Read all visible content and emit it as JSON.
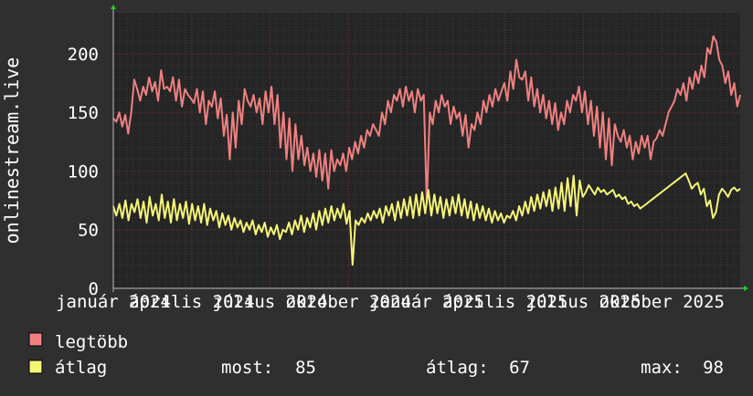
{
  "chart_data": {
    "type": "line",
    "ylabel": "onlinestream.live",
    "ylim": [
      0,
      235
    ],
    "yticks": [
      0,
      50,
      100,
      150,
      200
    ],
    "x_ticks": [
      {
        "pos": 0.0,
        "label": "január 2024"
      },
      {
        "pos": 0.125,
        "label": "április 2024"
      },
      {
        "pos": 0.25,
        "label": "július 2024"
      },
      {
        "pos": 0.375,
        "label": "október 2024"
      },
      {
        "pos": 0.5,
        "label": "január 2025"
      },
      {
        "pos": 0.625,
        "label": "április 2025"
      },
      {
        "pos": 0.75,
        "label": "július 2025"
      },
      {
        "pos": 0.875,
        "label": "október 2025"
      }
    ],
    "grid": true,
    "series": [
      {
        "name": "legtöbb",
        "color": "#f08080",
        "values": [
          145,
          142,
          150,
          138,
          148,
          132,
          150,
          178,
          170,
          160,
          172,
          165,
          180,
          168,
          176,
          160,
          186,
          170,
          172,
          168,
          180,
          160,
          178,
          155,
          170,
          165,
          162,
          158,
          170,
          150,
          168,
          140,
          160,
          155,
          168,
          145,
          162,
          130,
          148,
          110,
          150,
          120,
          160,
          140,
          170,
          160,
          155,
          165,
          150,
          162,
          140,
          168,
          150,
          172,
          140,
          165,
          120,
          150,
          110,
          145,
          100,
          140,
          110,
          130,
          105,
          120,
          100,
          115,
          95,
          118,
          92,
          115,
          85,
          118,
          100,
          110,
          105,
          115,
          100,
          120,
          110,
          125,
          115,
          130,
          120,
          135,
          130,
          140,
          135,
          130,
          150,
          140,
          160,
          150,
          165,
          160,
          170,
          155,
          172,
          160,
          168,
          150,
          170,
          160,
          165,
          72,
          150,
          140,
          160,
          150,
          165,
          155,
          160,
          140,
          155,
          145,
          150,
          130,
          148,
          120,
          140,
          135,
          150,
          140,
          160,
          150,
          165,
          155,
          170,
          160,
          168,
          175,
          160,
          185,
          170,
          195,
          180,
          178,
          185,
          160,
          180,
          155,
          170,
          150,
          165,
          145,
          160,
          140,
          158,
          135,
          150,
          140,
          160,
          150,
          165,
          160,
          172,
          150,
          168,
          140,
          160,
          130,
          155,
          120,
          150,
          110,
          145,
          105,
          140,
          130,
          125,
          135,
          120,
          130,
          110,
          125,
          115,
          130,
          120,
          130,
          110,
          125,
          128,
          135,
          130,
          140,
          150,
          155,
          160,
          170,
          165,
          175,
          160,
          180,
          170,
          185,
          175,
          190,
          180,
          205,
          200,
          215,
          210,
          195,
          190,
          175,
          185,
          165,
          175,
          155,
          165
        ],
        "now": null,
        "avg": null,
        "max": null
      },
      {
        "name": "átlag",
        "color": "#f5f578",
        "values": [
          70,
          62,
          72,
          60,
          75,
          58,
          72,
          65,
          76,
          60,
          74,
          56,
          78,
          62,
          72,
          58,
          80,
          60,
          74,
          56,
          76,
          58,
          72,
          60,
          74,
          55,
          72,
          58,
          70,
          56,
          72,
          54,
          68,
          58,
          66,
          52,
          64,
          54,
          62,
          50,
          60,
          52,
          58,
          48,
          56,
          50,
          58,
          46,
          54,
          48,
          56,
          44,
          52,
          46,
          54,
          42,
          50,
          48,
          56,
          46,
          58,
          50,
          62,
          48,
          60,
          52,
          64,
          50,
          66,
          54,
          68,
          56,
          70,
          58,
          68,
          60,
          72,
          55,
          66,
          20,
          58,
          54,
          60,
          56,
          64,
          58,
          66,
          60,
          68,
          56,
          70,
          62,
          72,
          58,
          74,
          60,
          76,
          62,
          78,
          60,
          80,
          62,
          82,
          64,
          84,
          62,
          80,
          64,
          78,
          60,
          76,
          62,
          78,
          64,
          80,
          62,
          76,
          60,
          74,
          58,
          72,
          60,
          70,
          58,
          68,
          56,
          66,
          58,
          64,
          56,
          62,
          60,
          66,
          58,
          70,
          62,
          74,
          64,
          78,
          66,
          80,
          68,
          82,
          70,
          84,
          66,
          86,
          68,
          90,
          66,
          94,
          70,
          96,
          62,
          92,
          78,
          82,
          88,
          84,
          80,
          86,
          82,
          84,
          80,
          82,
          84,
          78,
          80,
          76,
          78,
          72,
          74,
          70,
          72,
          68,
          70,
          72,
          74,
          76,
          78,
          80,
          82,
          84,
          86,
          88,
          90,
          92,
          94,
          96,
          98,
          92,
          85,
          88,
          90,
          80,
          85,
          70,
          75,
          60,
          65,
          80,
          85,
          82,
          78,
          84,
          86,
          83,
          85
        ],
        "now": 85,
        "avg": 67,
        "max": 98
      }
    ]
  },
  "legend": [
    {
      "label": "legtöbb",
      "color": "#f08080"
    },
    {
      "label": "átlag",
      "color": "#f5f578"
    }
  ],
  "stats": {
    "now_label": "most:",
    "now_value": "85",
    "avg_label": "átlag:",
    "avg_value": "67",
    "max_label": "max:",
    "max_value": "98"
  }
}
